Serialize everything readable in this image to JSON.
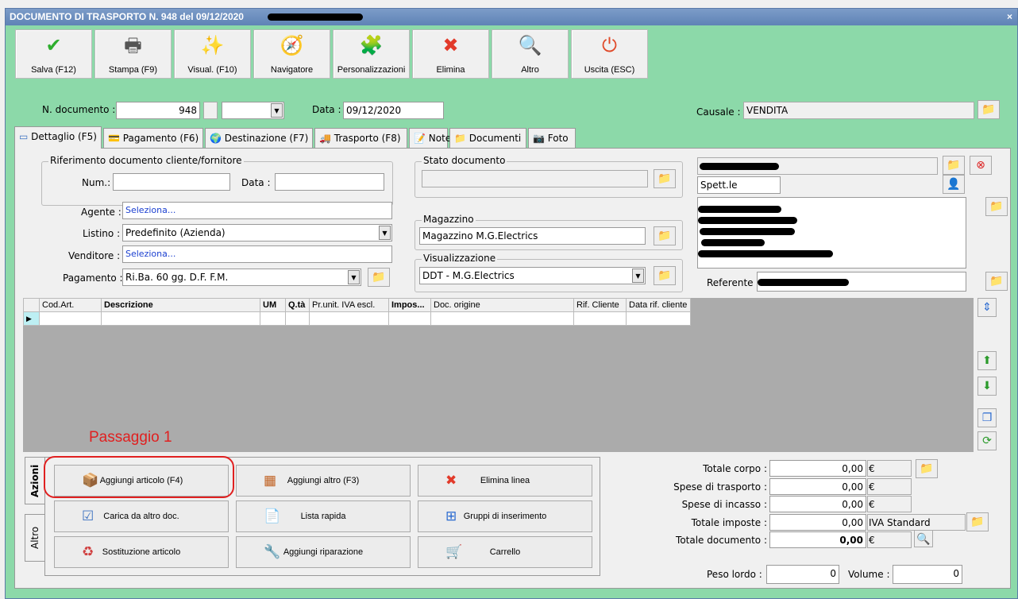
{
  "window": {
    "title": "DOCUMENTO DI TRASPORTO N. 948 del 09/12/2020",
    "close": "×"
  },
  "toolbar": [
    {
      "label": "Salva (F12)",
      "icon": "✔",
      "color": "#2eae2e"
    },
    {
      "label": "Stampa (F9)",
      "icon": "🖶",
      "color": "#555"
    },
    {
      "label": "Visual. (F10)",
      "icon": "✨",
      "color": "#d9a400"
    },
    {
      "label": "Navigatore",
      "icon": "🧭",
      "color": "#6a6ab8"
    },
    {
      "label": "Personalizzazioni",
      "icon": "🧩",
      "color": "#5cc02a"
    },
    {
      "label": "Elimina",
      "icon": "✖",
      "color": "#e23a2a"
    },
    {
      "label": "Altro",
      "icon": "🔍",
      "color": "#2a6ad0"
    },
    {
      "label": "Uscita (ESC)",
      "icon": "⏻",
      "color": "#e04a2a"
    }
  ],
  "header": {
    "num_label": "N. documento :",
    "num_value": "948",
    "data_label": "Data :",
    "data_value": "09/12/2020",
    "causale_label": "Causale :",
    "causale_value": "VENDITA"
  },
  "tabs": [
    "Dettaglio (F5)",
    "Pagamento (F6)",
    "Destinazione (F7)",
    "Trasporto (F8)",
    "Note",
    "Documenti",
    "Foto"
  ],
  "rif": {
    "title": "Riferimento documento cliente/fornitore",
    "num_label": "Num.:",
    "data_label": "Data :",
    "num_value": "",
    "data_value": ""
  },
  "form": {
    "agente_label": "Agente :",
    "agente_value": "Seleziona...",
    "listino_label": "Listino :",
    "listino_value": "Predefinito (Azienda)",
    "venditore_label": "Venditore :",
    "venditore_value": "Seleziona...",
    "pagamento_label": "Pagamento :",
    "pagamento_value": "Ri.Ba. 60 gg. D.F. F.M."
  },
  "stato": {
    "title": "Stato documento",
    "value": ""
  },
  "magazzino": {
    "title": "Magazzino",
    "value": "Magazzino M.G.Electrics"
  },
  "visualizzazione": {
    "title": "Visualizzazione",
    "value": "DDT - M.G.Electrics"
  },
  "cliente": {
    "salutation": "Spett.le",
    "referente_label": "Referente"
  },
  "grid": {
    "columns": [
      "Cod.Art.",
      "Descrizione",
      "UM",
      "Q.tà",
      "Pr.unit. IVA escl.",
      "Impos...",
      "Doc. origine",
      "Rif. Cliente",
      "Data rif. cliente"
    ]
  },
  "annotation": "Passaggio  1",
  "side_tabs": [
    "Azioni",
    "Altro"
  ],
  "actions": [
    {
      "label": "Aggiungi articolo (F4)",
      "icon": "📦"
    },
    {
      "label": "Aggiungi altro (F3)",
      "icon": "▦"
    },
    {
      "label": "Elimina linea",
      "icon": "✖"
    },
    {
      "label": "Carica da altro doc.",
      "icon": "☑"
    },
    {
      "label": "Lista rapida",
      "icon": "📄"
    },
    {
      "label": "Gruppi di inserimento",
      "icon": "⊞"
    },
    {
      "label": "Sostituzione articolo",
      "icon": "♻"
    },
    {
      "label": "Aggiungi riparazione",
      "icon": "🔧"
    },
    {
      "label": "Carrello",
      "icon": "🛒"
    }
  ],
  "totals": [
    {
      "label": "Totale corpo :",
      "value": "0,00",
      "unit": "€"
    },
    {
      "label": "Spese di trasporto :",
      "value": "0,00",
      "unit": "€"
    },
    {
      "label": "Spese di incasso :",
      "value": "0,00",
      "unit": "€"
    },
    {
      "label": "Totale imposte :",
      "value": "0,00",
      "unit": "IVA Standard"
    },
    {
      "label": "Totale documento :",
      "value": "0,00",
      "unit": "€"
    }
  ],
  "peso": {
    "label": "Peso lordo :",
    "value": "0"
  },
  "volume": {
    "label": "Volume :",
    "value": "0"
  }
}
